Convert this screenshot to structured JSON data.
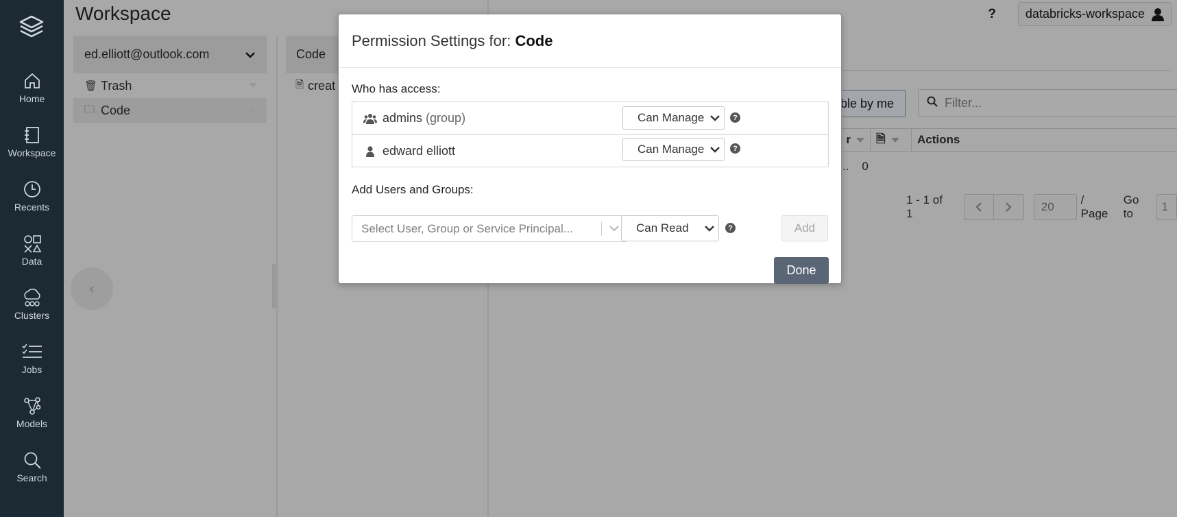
{
  "nav": {
    "items": [
      {
        "label": "Home",
        "icon": "home-icon"
      },
      {
        "label": "Workspace",
        "icon": "workspace-icon"
      },
      {
        "label": "Recents",
        "icon": "recents-icon"
      },
      {
        "label": "Data",
        "icon": "data-icon"
      },
      {
        "label": "Clusters",
        "icon": "clusters-icon"
      },
      {
        "label": "Jobs",
        "icon": "jobs-icon"
      },
      {
        "label": "Models",
        "icon": "models-icon"
      },
      {
        "label": "Search",
        "icon": "search-icon"
      }
    ]
  },
  "workspace": {
    "title": "Workspace",
    "user_folder": "ed.elliott@outlook.com",
    "tree": [
      {
        "label": "Trash",
        "icon": "trash-icon"
      },
      {
        "label": "Code",
        "icon": "folder-icon"
      }
    ],
    "col2_header": "Code",
    "col2_item": "creat"
  },
  "header": {
    "help": "?",
    "workspace_name": "databricks-workspace"
  },
  "list": {
    "accessible_button": "Accessible by me",
    "filter_placeholder": "Filter...",
    "col_owner_fragment": "r",
    "col_actions": "Actions",
    "row_owner_fragment": "tt...",
    "row_count": "0",
    "pager_range": "1 - 1 of 1",
    "page_size": "20",
    "per_page": "/ Page",
    "goto_label": "Go to",
    "goto_value": "1"
  },
  "modal": {
    "title_prefix": "Permission Settings for: ",
    "title_name": "Code",
    "who_label": "Who has access:",
    "acl": [
      {
        "name": "admins",
        "suffix": "(group)",
        "permission": "Can Manage",
        "icon": "group-icon"
      },
      {
        "name": "edward elliott",
        "suffix": "",
        "permission": "Can Manage",
        "icon": "user-icon"
      }
    ],
    "add_label": "Add Users and Groups:",
    "picker_placeholder": "Select User, Group or Service Principal...",
    "new_permission": "Can Read",
    "add_button": "Add",
    "done_button": "Done",
    "help_glyph": "?"
  },
  "colors": {
    "nav_bg": "#1b2a33",
    "overlay": "#a8a8a8",
    "done_bg": "#5a6676"
  }
}
